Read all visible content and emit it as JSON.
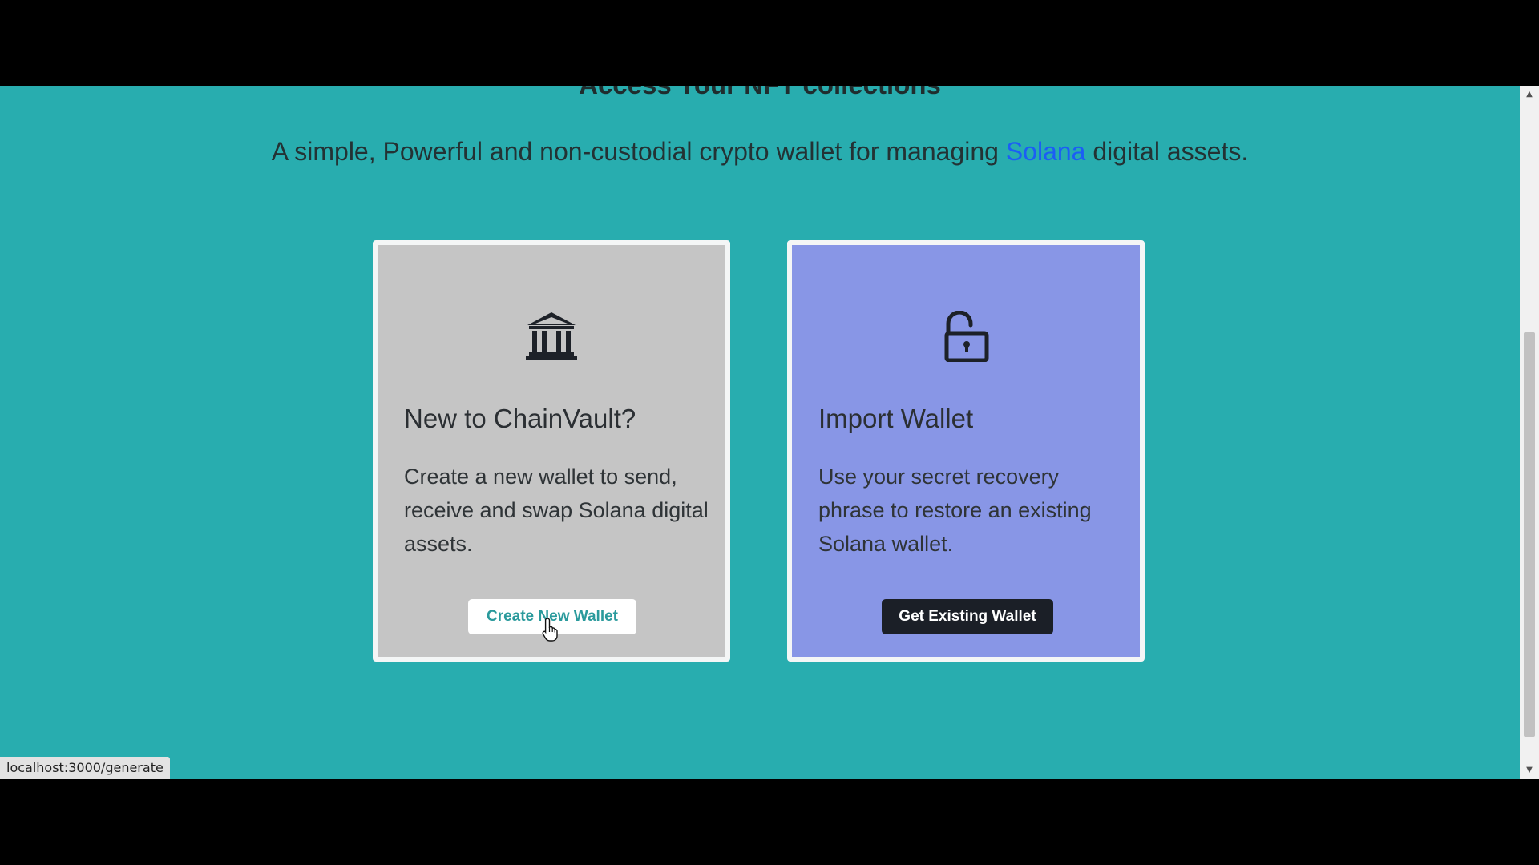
{
  "page": {
    "heading": "Access Your NFT collections",
    "tagline_before": "A simple, Powerful and non-custodial crypto wallet for managing ",
    "tagline_link": "Solana",
    "tagline_after": " digital assets."
  },
  "cards": {
    "new_wallet": {
      "icon": "bank-icon",
      "title": "New to ChainVault?",
      "text": "Create a new wallet to send, receive and swap Solana digital assets.",
      "button_label": "Create New Wallet"
    },
    "import_wallet": {
      "icon": "unlock-icon",
      "title": "Import Wallet",
      "text": "Use your secret recovery phrase to restore an existing Solana wallet.",
      "button_label": "Get Existing Wallet"
    }
  },
  "status_bar": {
    "url": "localhost:3000/generate"
  },
  "colors": {
    "background": "#28adaf",
    "card_new": "#c5c5c5",
    "card_import": "#8896e6",
    "link": "#1b5ef5"
  }
}
